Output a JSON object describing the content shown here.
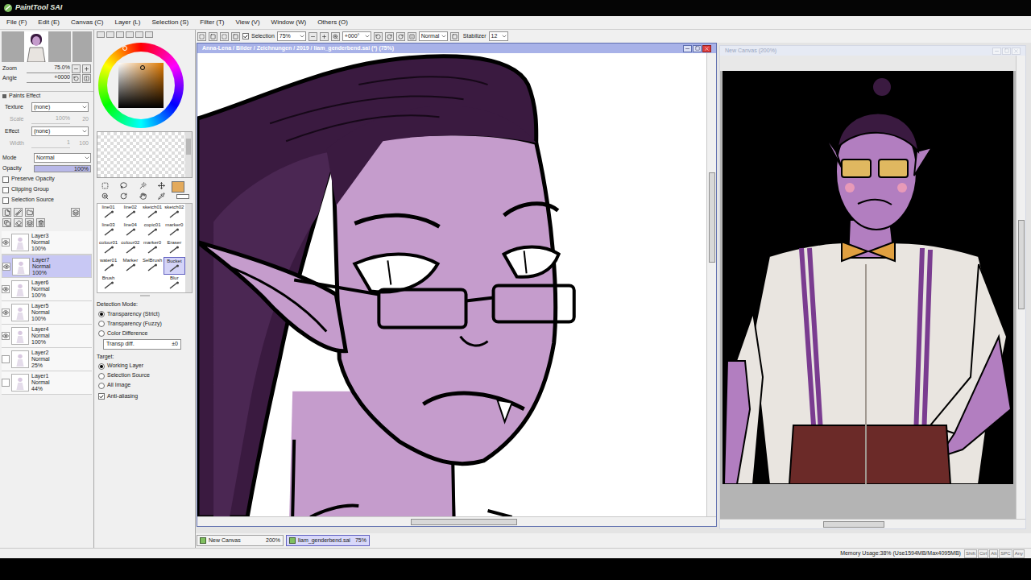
{
  "app": {
    "logo": "PaintTool SAI"
  },
  "menu": [
    "File (F)",
    "Edit (E)",
    "Canvas (C)",
    "Layer (L)",
    "Selection (S)",
    "Filter (T)",
    "View (V)",
    "Window (W)",
    "Others (O)"
  ],
  "navigator": {
    "zoom_label": "Zoom",
    "zoom": "75.0%",
    "angle_label": "Angle",
    "angle": "+0000"
  },
  "paints_effect": {
    "title": "Paints Effect",
    "rows": [
      {
        "label": "Texture",
        "value": "(none)",
        "kind": "select",
        "disabled": false
      },
      {
        "label": "Scale",
        "value": "100%",
        "extra": "20",
        "kind": "slider",
        "disabled": true
      },
      {
        "label": "Effect",
        "value": "(none)",
        "kind": "select",
        "disabled": false
      },
      {
        "label": "Width",
        "value": "1",
        "extra": "100",
        "kind": "slider",
        "disabled": true
      }
    ]
  },
  "layer_props": {
    "mode_label": "Mode",
    "mode": "Normal",
    "opacity_label": "Opacity",
    "opacity": "100%",
    "opacity_level": 1,
    "checkboxes": [
      {
        "label": "Preserve Opacity",
        "checked": false
      },
      {
        "label": "Clipping Group",
        "checked": false
      },
      {
        "label": "Selection Source",
        "checked": false
      }
    ]
  },
  "layers": [
    {
      "name": "Layer3",
      "mode": "Normal",
      "opacity": "100%",
      "visible": true,
      "selected": false
    },
    {
      "name": "Layer7",
      "mode": "Normal",
      "opacity": "100%",
      "visible": true,
      "selected": true
    },
    {
      "name": "Layer6",
      "mode": "Normal",
      "opacity": "100%",
      "visible": true,
      "selected": false
    },
    {
      "name": "Layer5",
      "mode": "Normal",
      "opacity": "100%",
      "visible": true,
      "selected": false
    },
    {
      "name": "Layer4",
      "mode": "Normal",
      "opacity": "100%",
      "visible": true,
      "selected": false
    },
    {
      "name": "Layer2",
      "mode": "Normal",
      "opacity": "25%",
      "visible": false,
      "selected": false
    },
    {
      "name": "Layer1",
      "mode": "Normal",
      "opacity": "44%",
      "visible": false,
      "selected": false
    }
  ],
  "color_picker": {
    "current_color": "#e3aa5c"
  },
  "brushes": [
    {
      "label": "line01",
      "selected": false
    },
    {
      "label": "line02",
      "selected": false
    },
    {
      "label": "sketch01",
      "selected": false
    },
    {
      "label": "sketch02",
      "selected": false
    },
    {
      "label": "line03",
      "selected": false
    },
    {
      "label": "line04",
      "selected": false
    },
    {
      "label": "copic01",
      "selected": false
    },
    {
      "label": "marker0",
      "selected": false
    },
    {
      "label": "colour01",
      "selected": false
    },
    {
      "label": "colour02",
      "selected": false
    },
    {
      "label": "marker0",
      "selected": false
    },
    {
      "label": "Eraser",
      "selected": false
    },
    {
      "label": "water01",
      "selected": false
    },
    {
      "label": "Marker",
      "selected": false
    },
    {
      "label": "SelBrush",
      "selected": false
    },
    {
      "label": "Bucket",
      "selected": true
    },
    {
      "label": "Brush",
      "selected": false
    },
    {
      "label": "",
      "selected": false
    },
    {
      "label": "",
      "selected": false
    },
    {
      "label": "Blur",
      "selected": false
    }
  ],
  "fill_options": {
    "detection_title": "Detection Mode:",
    "detection_modes": [
      {
        "label": "Transparency (Strict)",
        "selected": true
      },
      {
        "label": "Transparency (Fuzzy)",
        "selected": false
      },
      {
        "label": "Color Difference",
        "selected": false
      }
    ],
    "transp_diff": {
      "label": "Transp diff.",
      "value": "±0"
    },
    "target_title": "Target:",
    "targets": [
      {
        "label": "Working Layer",
        "selected": true
      },
      {
        "label": "Selection Source",
        "selected": false
      },
      {
        "label": "All Image",
        "selected": false
      }
    ],
    "anti_aliasing": {
      "label": "Anti-aliasing",
      "checked": true
    }
  },
  "toolbar": {
    "selection": {
      "label": "Selection",
      "checked": true
    },
    "zoom": "75%",
    "angle": "+000°",
    "blend": "Normal",
    "stabilizer_label": "Stabilizer",
    "stabilizer": "12"
  },
  "windows": [
    {
      "title": "Anna-Lena / Bilder / Zeichnungen / 2019 / liam_genderbend.sai (*) (75%)",
      "active": true,
      "h_scroll": 0.41,
      "v_scroll": 0.25
    },
    {
      "title": "New Canvas (200%)",
      "active": false,
      "h_scroll": 0.33,
      "v_scroll": 0.35
    }
  ],
  "doc_tabs": [
    {
      "label": "New Canvas",
      "zoom": "200%",
      "selected": false
    },
    {
      "label": "liam_genderbend.sai",
      "zoom": "75%",
      "selected": true
    }
  ],
  "status_bar": {
    "memory": "Memory Usage:38% (Use1594MB/Max4095MB)",
    "keys": [
      "Shift",
      "Ctrl",
      "Alt",
      "SPC",
      "Any"
    ]
  }
}
